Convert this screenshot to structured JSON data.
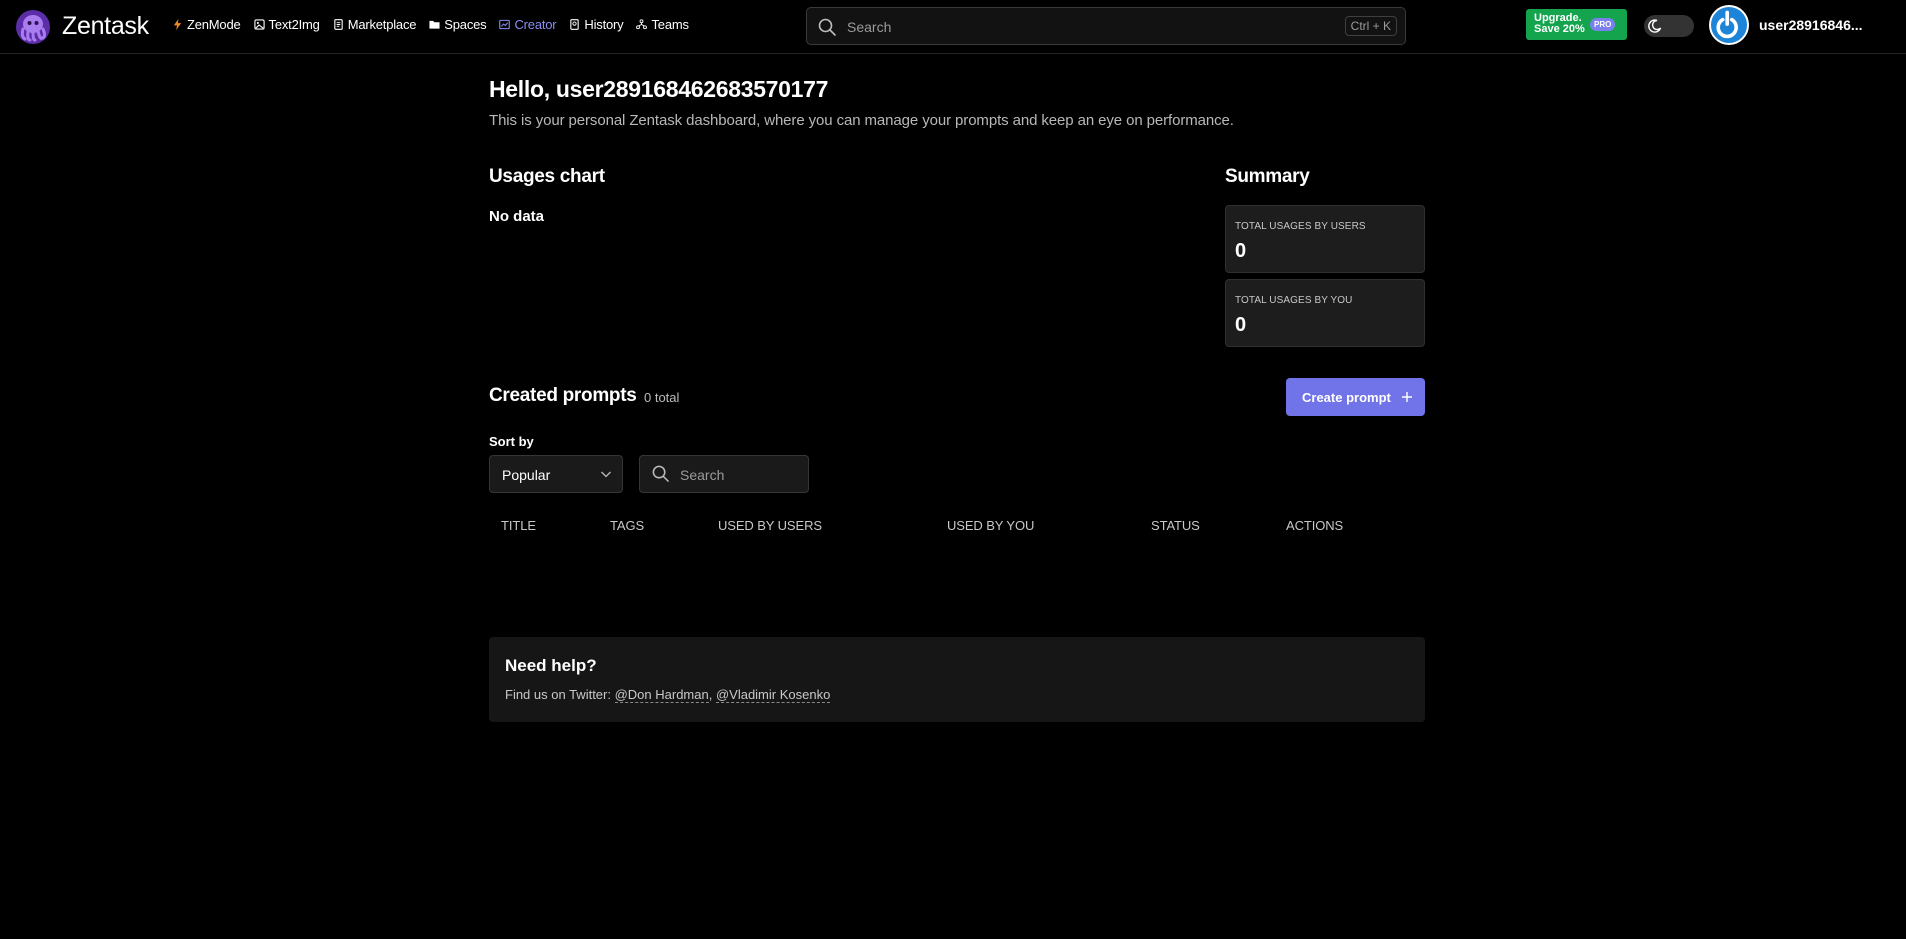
{
  "header": {
    "brand": "Zentask",
    "nav": [
      {
        "label": "ZenMode",
        "icon": "bolt-icon"
      },
      {
        "label": "Text2Img",
        "icon": "image-icon"
      },
      {
        "label": "Marketplace",
        "icon": "document-icon"
      },
      {
        "label": "Spaces",
        "icon": "folder-icon"
      },
      {
        "label": "Creator",
        "icon": "chart-icon",
        "active": true
      },
      {
        "label": "History",
        "icon": "book-icon"
      },
      {
        "label": "Teams",
        "icon": "team-icon"
      }
    ],
    "search_placeholder": "Search",
    "search_shortcut": "Ctrl + K",
    "upgrade_line1": "Upgrade.",
    "upgrade_line2": "Save 20%",
    "upgrade_badge": "PRO",
    "username": "user28916846..."
  },
  "main": {
    "hello": "Hello, user289168462683570177",
    "subtitle": "This is your personal Zentask dashboard, where you can manage your prompts and keep an eye on performance.",
    "usages_title": "Usages chart",
    "no_data": "No data",
    "summary_title": "Summary",
    "summary_cards": [
      {
        "label": "TOTAL USAGES BY USERS",
        "value": "0"
      },
      {
        "label": "TOTAL USAGES BY YOU",
        "value": "0"
      }
    ],
    "created_title": "Created prompts",
    "created_count": "0 total",
    "create_button": "Create prompt",
    "sort_label": "Sort by",
    "sort_value": "Popular",
    "search_placeholder": "Search",
    "table_headers": [
      "TITLE",
      "TAGS",
      "USED BY USERS",
      "USED BY YOU",
      "STATUS",
      "ACTIONS"
    ]
  },
  "help": {
    "title": "Need help?",
    "prefix": "Find us on Twitter: ",
    "link1": "@Don Hardman",
    "separator": ", ",
    "link2": "@Vladimir Kosenko"
  },
  "colors": {
    "background": "#000000",
    "accent": "#7174e8",
    "nav_active": "#8b8df4",
    "upgrade_green": "#14a44d",
    "avatar_blue": "#1e84d8"
  }
}
